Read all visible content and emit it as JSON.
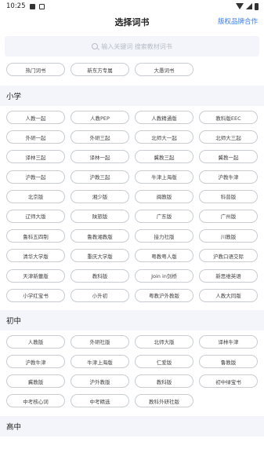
{
  "status_bar": {
    "time": "10:25"
  },
  "header": {
    "title": "选择词书",
    "right_link": "版权品牌合作"
  },
  "search": {
    "placeholder": "输入关键词 搜索教材词书"
  },
  "top_chips": [
    "热门词书",
    "新东方专属",
    "大愚词书"
  ],
  "sections": [
    {
      "title": "小学",
      "items": [
        "人教一起",
        "人教PEP",
        "人教精通版",
        "教科版EEC",
        "外研一起",
        "外研三起",
        "北师大一起",
        "北师大三起",
        "译林三起",
        "译林一起",
        "冀教三起",
        "冀教一起",
        "沪教一起",
        "沪教三起",
        "牛津上海版",
        "沪教牛津",
        "北京版",
        "湘少版",
        "闽教版",
        "科普版",
        "辽师大版",
        "陕旅版",
        "广东版",
        "广州版",
        "鲁科五四制",
        "鲁教湘教版",
        "接力社版",
        "川教版",
        "清华大学版",
        "重庆大学版",
        "粤教粤人版",
        "沪教口语交际",
        "天津新蕾版",
        "教科版",
        "Join in剑桥",
        "新思维英语",
        "小学红宝书",
        "小升初",
        "粤教沪外教版",
        "人教大同版"
      ]
    },
    {
      "title": "初中",
      "items": [
        "人教版",
        "外研社版",
        "北师大版",
        "译林牛津",
        "沪教牛津",
        "牛津上海版",
        "仁爱版",
        "鲁教版",
        "冀教版",
        "沪外教版",
        "教科版",
        "初中绿宝书",
        "中考核心词",
        "中考精选",
        "教科外研社版"
      ]
    },
    {
      "title": "高中",
      "items": []
    }
  ]
}
